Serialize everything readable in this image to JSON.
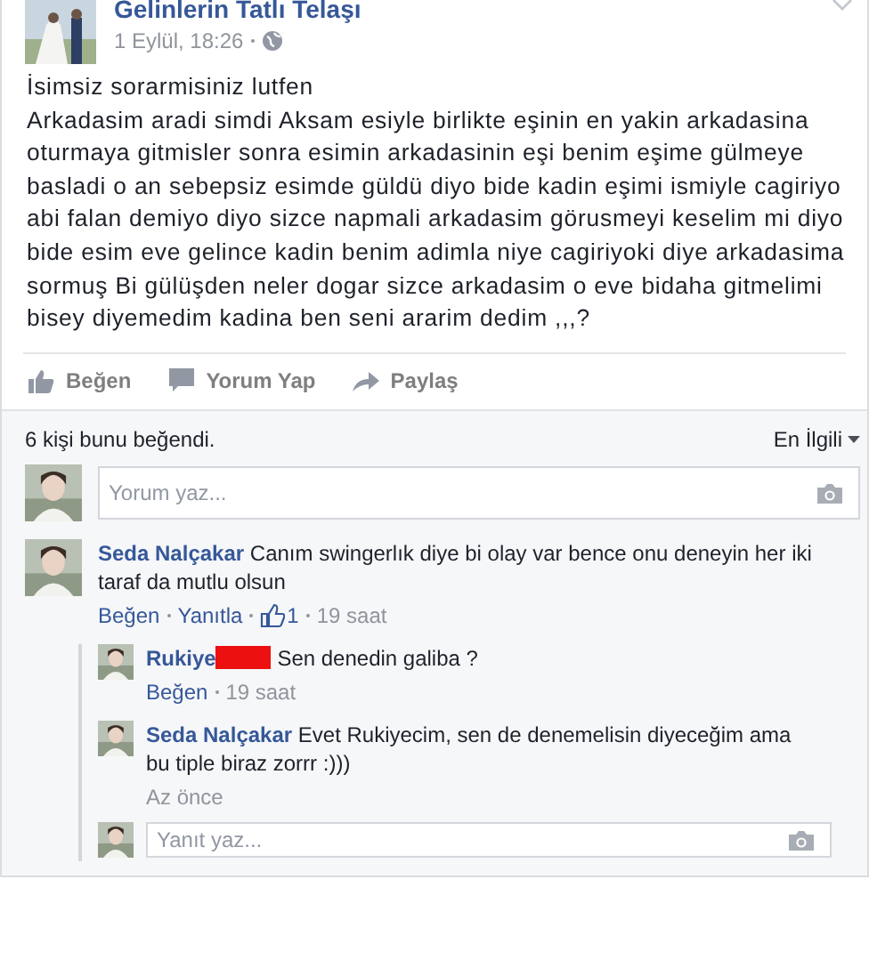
{
  "post": {
    "page_name": "Gelinlerin Tatlı Telaşı",
    "timestamp": "1 Eylül, 18:26",
    "public": true,
    "body": [
      "İsimsiz sorarmisiniz lutfen",
      "Arkadasim aradi simdi Aksam esiyle birlikte eşinin en yakin arkadasina oturmaya gitmisler sonra esimin arkadasinin eşi benim eşime gülmeye basladi o an sebepsiz esimde güldü diyo bide kadin eşimi ismiyle cagiriyo abi falan demiyo diyo sizce napmali arkadasim görusmeyi keselim mi diyo bide esim eve gelince kadin benim adimla niye cagiriyoki diye arkadasima sormuş Bi gülüşden neler dogar sizce arkadasim o eve bidaha gitmelimi bisey diyemedim kadina ben seni ararim dedim ,,,?"
    ]
  },
  "actions": [
    {
      "label": "Beğen",
      "kind": "like"
    },
    {
      "label": "Yorum Yap",
      "kind": "comment"
    },
    {
      "label": "Paylaş",
      "kind": "share"
    }
  ],
  "likes_summary": "6 kişi bunu beğendi.",
  "sort": "En İlgili",
  "comment_box": {
    "placeholder": "Yorum yaz..."
  },
  "comments": [
    {
      "author": "Seda Nalçakar",
      "text": "Canım swingerlık diye bi olay var bence onu deneyin her iki taraf da mutlu olsun",
      "links": [
        "Beğen",
        "Yanıtla"
      ],
      "like_count": "1",
      "time": "19 saat",
      "replies": [
        {
          "author": "Rukiye",
          "redacted": true,
          "text": "Sen denedin galiba ?",
          "links": [
            "Beğen"
          ],
          "time": "19 saat"
        },
        {
          "author": "Seda Nalçakar",
          "redacted": false,
          "text": "Evet Rukiyecim, sen de denemelisin diyeceğim ama bu tiple biraz zorrr :)))",
          "time": "Az önce"
        }
      ],
      "reply_box": {
        "placeholder": "Yanıt yaz..."
      }
    }
  ]
}
